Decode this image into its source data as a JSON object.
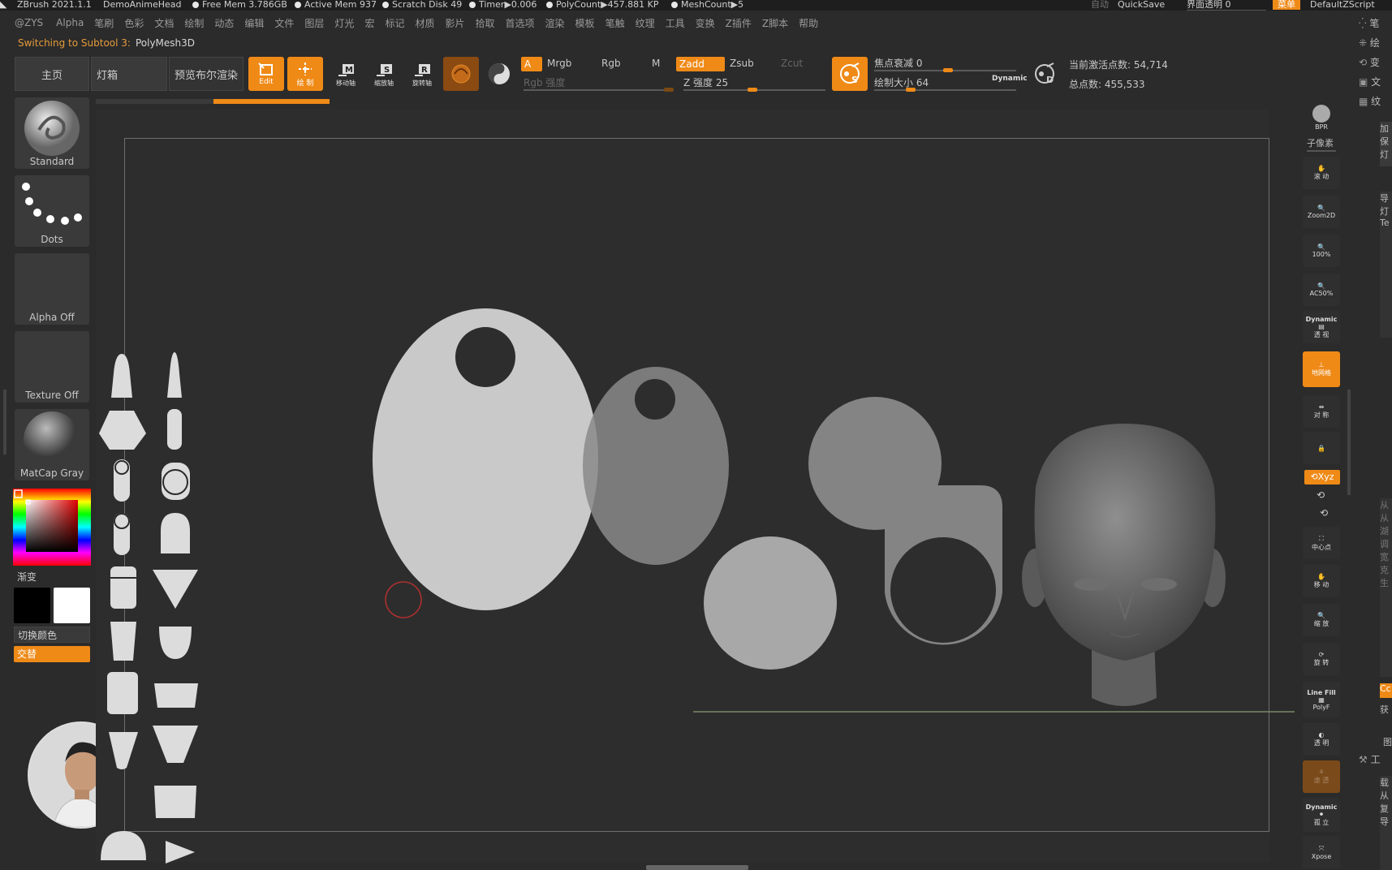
{
  "titlebar": {
    "app": "ZBrush 2021.1.1",
    "document": "DemoAnimeHead",
    "free_mem": "Free Mem 3.786GB",
    "active_mem": "Active Mem 937",
    "scratch_disk": "Scratch Disk 49",
    "timer": "Timer▶0.006",
    "polycount": "PolyCount▶457.881 KP",
    "meshcount": "MeshCount▶5",
    "auto": "自动",
    "quicksave": "QuickSave",
    "transparency": "界面透明 0",
    "menu": "菜单",
    "zscript": "DefaultZScript"
  },
  "menu": [
    "@ZYS",
    "Alpha",
    "笔刷",
    "色彩",
    "文档",
    "绘制",
    "动态",
    "编辑",
    "文件",
    "图层",
    "灯光",
    "宏",
    "标记",
    "材质",
    "影片",
    "拾取",
    "首选项",
    "渲染",
    "模板",
    "笔触",
    "纹理",
    "工具",
    "变换",
    "Z插件",
    "Z脚本",
    "帮助"
  ],
  "notice": {
    "prefix": "Switching to Subtool 3:",
    "name": "PolyMesh3D"
  },
  "toolbar": {
    "home": "主页",
    "lightbox": "灯箱",
    "bpr_preview": "预览布尔渲染",
    "edit": "Edit",
    "draw": "绘 制",
    "move": "移动轴",
    "scale": "缩放轴",
    "rotate": "旋转轴",
    "a": "A",
    "mrgb": "Mrgb",
    "rgb": "Rgb",
    "m": "M",
    "zadd": "Zadd",
    "zsub": "Zsub",
    "zcut": "Zcut",
    "rgb_intensity": "Rgb 强度",
    "z_intensity": "Z 强度 25",
    "focal_shift": "焦点衰减 0",
    "draw_size": "绘制大小 64",
    "dynamic": "Dynamic",
    "active_points": "当前激活点数: 54,714",
    "total_points": "总点数: 455,533",
    "s_label": "S",
    "d_label": "D"
  },
  "left": {
    "brush": "Standard",
    "stroke": "Dots",
    "alpha": "Alpha Off",
    "texture": "Texture Off",
    "material": "MatCap Gray",
    "gradient": "渐变",
    "switch_color": "切换颜色",
    "alternate": "交替"
  },
  "right": {
    "bpr": "BPR",
    "subpixel": "子像素",
    "scroll": "滚 动",
    "zoom2d": "Zoom2D",
    "hundred": "100%",
    "ac50": "AC50%",
    "dynamic": "Dynamic",
    "persp": "透 视",
    "floor": "地网格",
    "sym": "对 称",
    "lock": "",
    "xyz": "Xyz",
    "center": "中心点",
    "move": "移 动",
    "scale": "缩 放",
    "rotate": "旋 转",
    "linefill": "Line Fill",
    "polyf": "PolyF",
    "transp": "透 明",
    "ghost": "虚 透",
    "dynamic2": "Dynamic",
    "solo": "孤 立",
    "xpose": "Xpose"
  },
  "farright": [
    "笔",
    "绘",
    "变",
    "文",
    "纹",
    "加",
    "保",
    "灯",
    "导",
    "灯",
    "Te",
    "从",
    "从",
    "湖",
    "调",
    "宽",
    "克",
    "生",
    "Cc",
    "获",
    "图",
    "工",
    "载",
    "从",
    "复",
    "导"
  ],
  "colors": {
    "accent": "#ef8a17",
    "bg": "#2b2b2b",
    "canvas": "#2d2d2d"
  }
}
